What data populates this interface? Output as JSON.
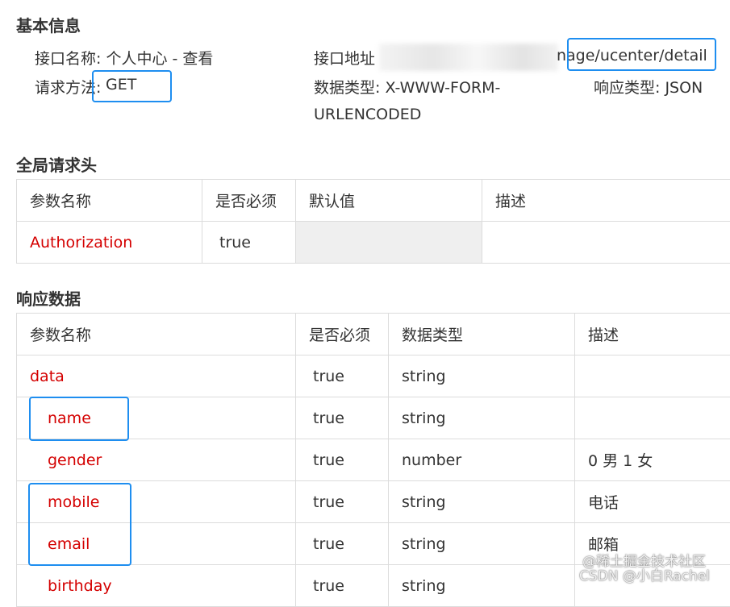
{
  "basic": {
    "heading": "基本信息",
    "name_label": "接口名称: 个人中心 - 查看",
    "url_label": "接口地址",
    "url_value": "nage/ucenter/detail",
    "method_label": "请求方法: ",
    "method_value": "GET",
    "data_type_line1": "数据类型: X-WWW-FORM-",
    "data_type_line2": "URLENCODED",
    "response_type": "响应类型: JSON"
  },
  "headers_section": {
    "heading": "全局请求头",
    "columns": [
      "参数名称",
      "是否必须",
      "默认值",
      "描述"
    ],
    "rows": [
      {
        "name": "Authorization",
        "required": "true",
        "default": "",
        "desc": ""
      }
    ]
  },
  "response_section": {
    "heading": "响应数据",
    "columns": [
      "参数名称",
      "是否必须",
      "数据类型",
      "描述"
    ],
    "rows": [
      {
        "name": "data",
        "required": "true",
        "type": "string",
        "desc": ""
      },
      {
        "name": "name",
        "required": "true",
        "type": "string",
        "desc": ""
      },
      {
        "name": "gender",
        "required": "true",
        "type": "number",
        "desc": "0 男 1 女"
      },
      {
        "name": "mobile",
        "required": "true",
        "type": "string",
        "desc": "电话"
      },
      {
        "name": "email",
        "required": "true",
        "type": "string",
        "desc": "邮箱"
      },
      {
        "name": "birthday",
        "required": "true",
        "type": "string",
        "desc": ""
      }
    ]
  },
  "watermark": {
    "line1": "@稀土掘金技术社区",
    "line2": "CSDN @小白Rachel"
  },
  "colors": {
    "param_red": "#d40000",
    "highlight_blue": "#1e8ef0",
    "border": "#dcdcdc"
  }
}
